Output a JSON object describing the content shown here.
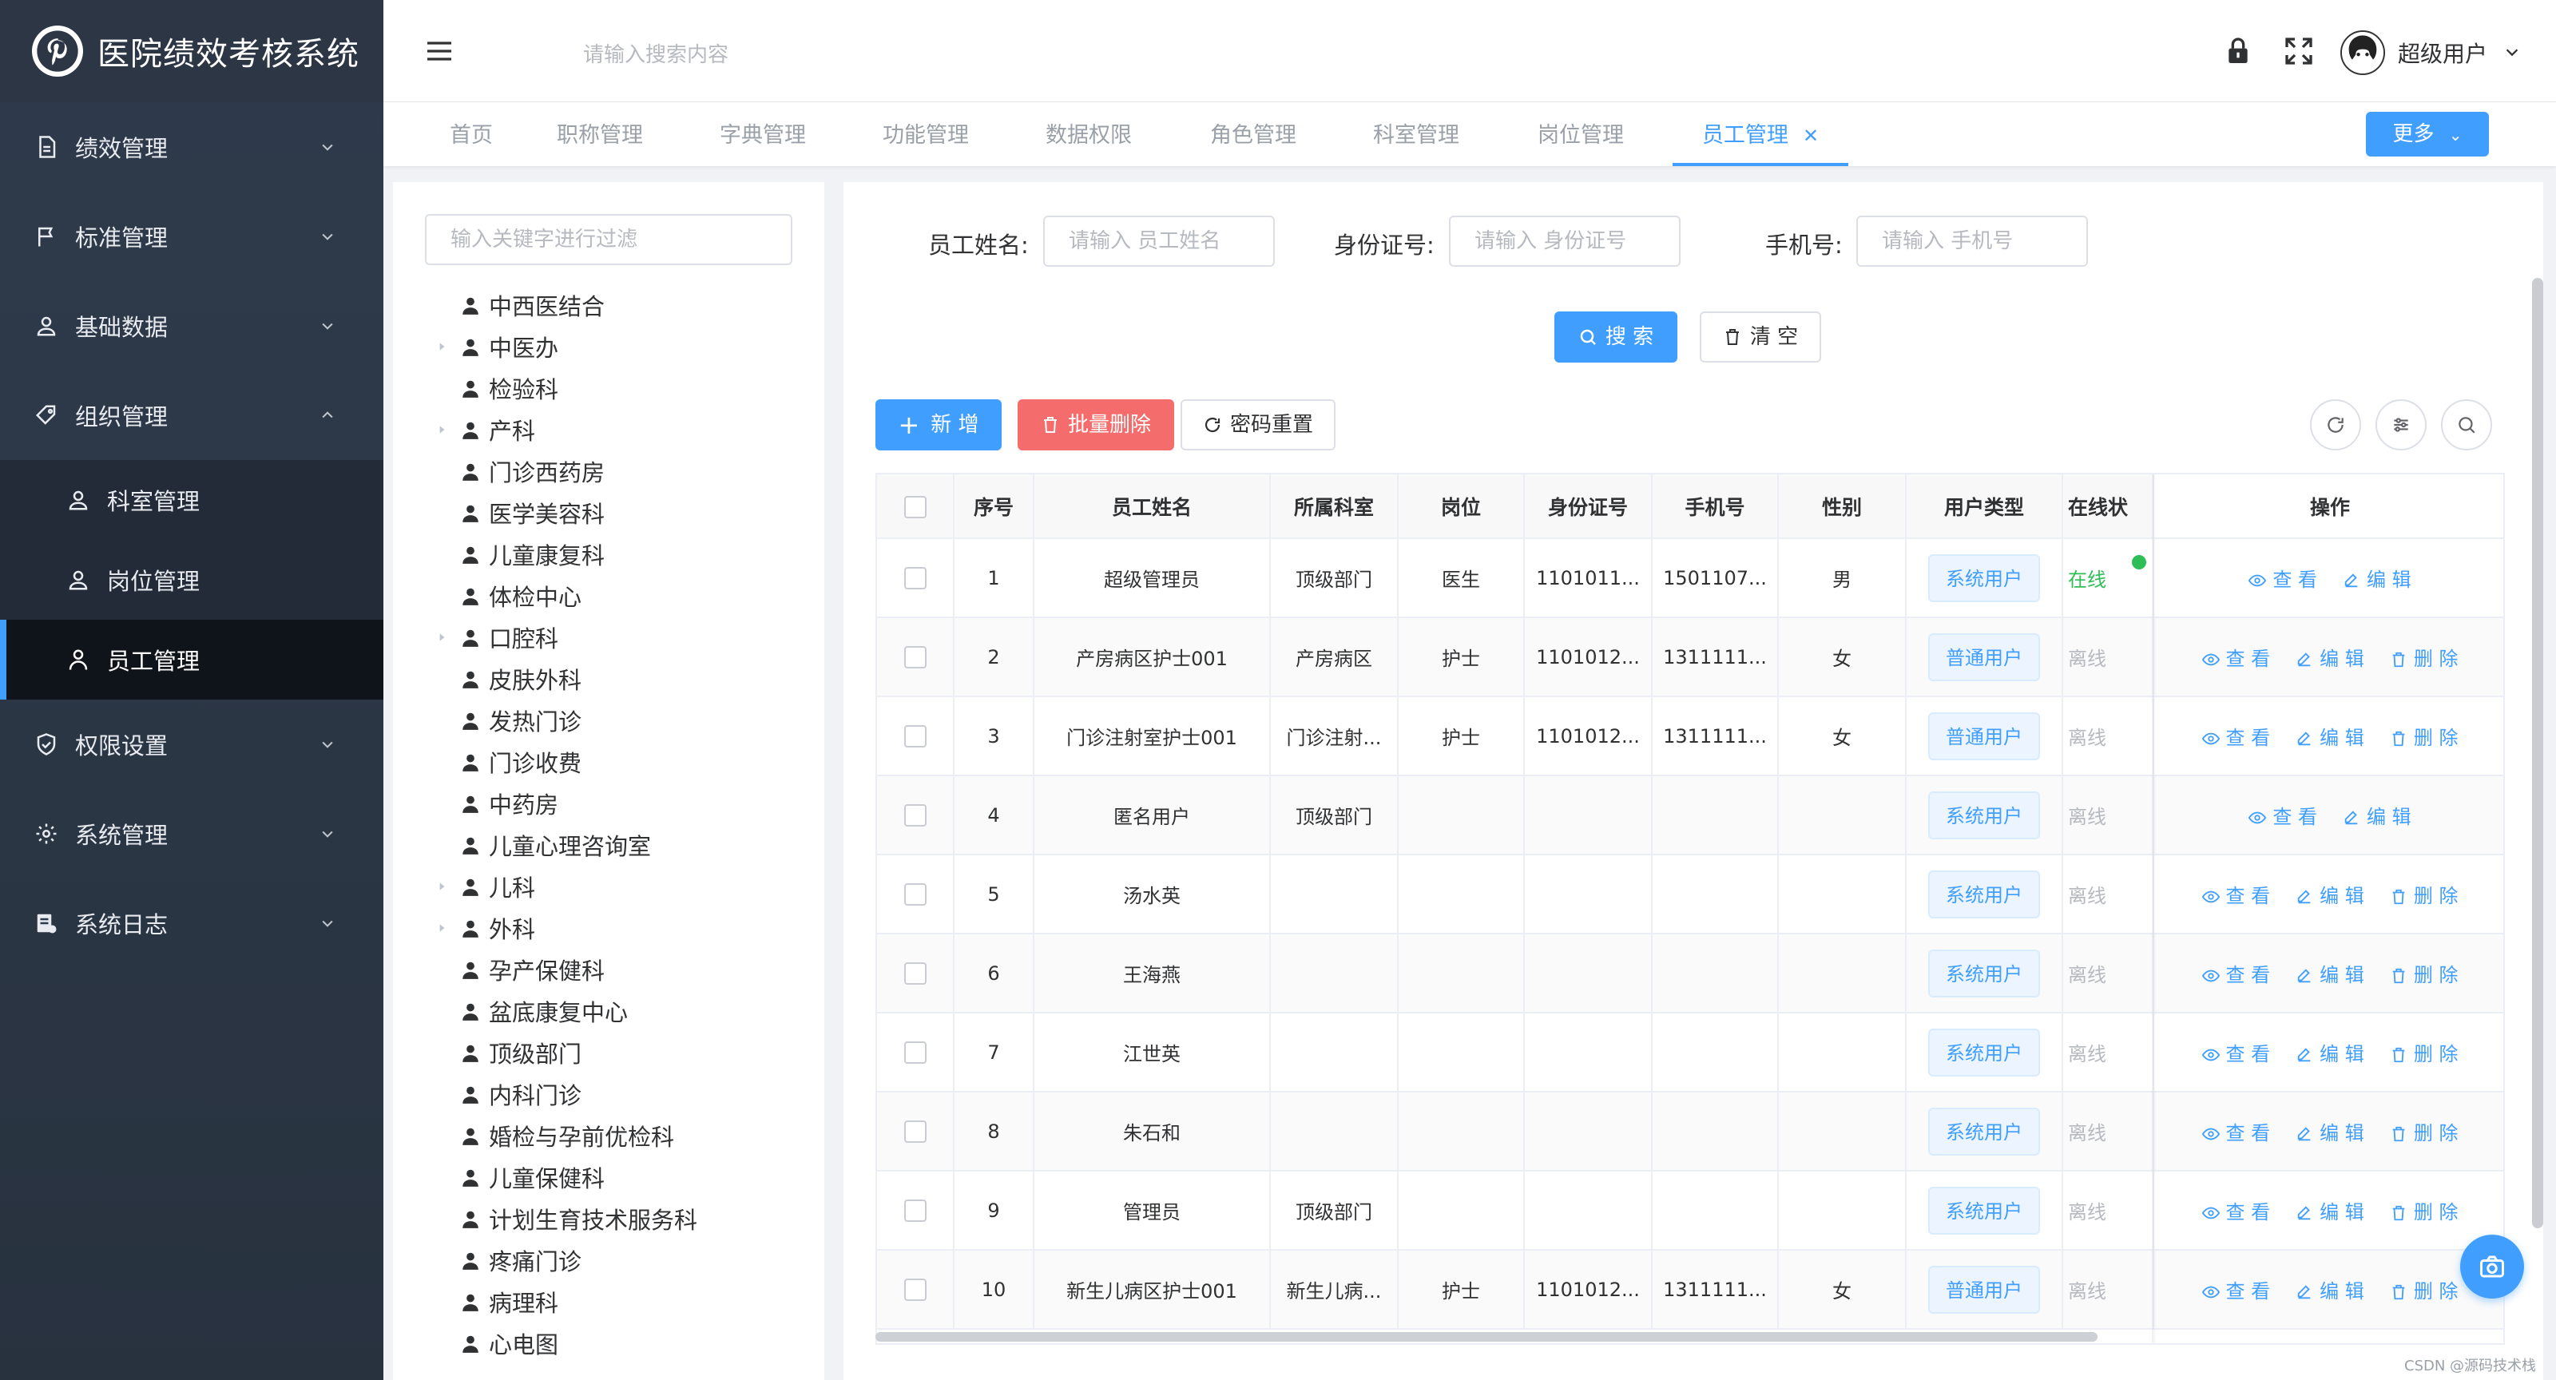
{
  "app": {
    "title": "医院绩效考核系统"
  },
  "sidebar": {
    "items": [
      {
        "label": "绩效管理",
        "icon": "document-icon"
      },
      {
        "label": "标准管理",
        "icon": "flag-icon"
      },
      {
        "label": "基础数据",
        "icon": "user-icon"
      },
      {
        "label": "组织管理",
        "icon": "tag-icon",
        "expanded": true
      },
      {
        "label": "科室管理",
        "icon": "user-icon",
        "sub": true
      },
      {
        "label": "岗位管理",
        "icon": "user-icon",
        "sub": true
      },
      {
        "label": "员工管理",
        "icon": "person-icon",
        "sub": true,
        "active": true
      },
      {
        "label": "权限设置",
        "icon": "shield-icon"
      },
      {
        "label": "系统管理",
        "icon": "gear-icon"
      },
      {
        "label": "系统日志",
        "icon": "log-icon"
      }
    ]
  },
  "header": {
    "search_placeholder": "请输入搜索内容",
    "username": "超级用户"
  },
  "tabs": {
    "items": [
      "首页",
      "职称管理",
      "字典管理",
      "功能管理",
      "数据权限",
      "角色管理",
      "科室管理",
      "岗位管理",
      "员工管理"
    ],
    "active_index": 8,
    "more_label": "更多"
  },
  "tree": {
    "filter_placeholder": "输入关键字进行过滤",
    "nodes": [
      {
        "label": "中西医结合",
        "expandable": false
      },
      {
        "label": "中医办",
        "expandable": true
      },
      {
        "label": "检验科",
        "expandable": false
      },
      {
        "label": "产科",
        "expandable": true
      },
      {
        "label": "门诊西药房",
        "expandable": false
      },
      {
        "label": "医学美容科",
        "expandable": false
      },
      {
        "label": "儿童康复科",
        "expandable": false
      },
      {
        "label": "体检中心",
        "expandable": false
      },
      {
        "label": "口腔科",
        "expandable": true
      },
      {
        "label": "皮肤外科",
        "expandable": false
      },
      {
        "label": "发热门诊",
        "expandable": false
      },
      {
        "label": "门诊收费",
        "expandable": false
      },
      {
        "label": "中药房",
        "expandable": false
      },
      {
        "label": "儿童心理咨询室",
        "expandable": false
      },
      {
        "label": "儿科",
        "expandable": true
      },
      {
        "label": "外科",
        "expandable": true
      },
      {
        "label": "孕产保健科",
        "expandable": false
      },
      {
        "label": "盆底康复中心",
        "expandable": false
      },
      {
        "label": "顶级部门",
        "expandable": false
      },
      {
        "label": "内科门诊",
        "expandable": false
      },
      {
        "label": "婚检与孕前优检科",
        "expandable": false
      },
      {
        "label": "儿童保健科",
        "expandable": false
      },
      {
        "label": "计划生育技术服务科",
        "expandable": false
      },
      {
        "label": "疼痛门诊",
        "expandable": false
      },
      {
        "label": "病理科",
        "expandable": false
      },
      {
        "label": "心电图",
        "expandable": false
      }
    ]
  },
  "search": {
    "name_label": "员工姓名:",
    "name_placeholder": "请输入 员工姓名",
    "id_label": "身份证号:",
    "id_placeholder": "请输入 身份证号",
    "phone_label": "手机号:",
    "phone_placeholder": "请输入 手机号",
    "search_button": "搜 索",
    "clear_button": "清 空"
  },
  "toolbar": {
    "add_button": "新 增",
    "batch_delete_button": "批量删除",
    "reset_password_button": "密码重置"
  },
  "table": {
    "columns": [
      "序号",
      "员工姓名",
      "所属科室",
      "岗位",
      "身份证号",
      "手机号",
      "性别",
      "用户类型",
      "在线状",
      "操作"
    ],
    "op_view": "查 看",
    "op_edit": "编 辑",
    "op_delete": "删 除",
    "rows": [
      {
        "no": "1",
        "name": "超级管理员",
        "dept": "顶级部门",
        "post": "医生",
        "id": "1101011...",
        "phone": "1501107...",
        "gender": "男",
        "type": "系统用户",
        "status": "在线",
        "deletable": false
      },
      {
        "no": "2",
        "name": "产房病区护士001",
        "dept": "产房病区",
        "post": "护士",
        "id": "1101012...",
        "phone": "1311111...",
        "gender": "女",
        "type": "普通用户",
        "status": "离线",
        "deletable": true
      },
      {
        "no": "3",
        "name": "门诊注射室护士001",
        "dept": "门诊注射...",
        "post": "护士",
        "id": "1101012...",
        "phone": "1311111...",
        "gender": "女",
        "type": "普通用户",
        "status": "离线",
        "deletable": true
      },
      {
        "no": "4",
        "name": "匿名用户",
        "dept": "顶级部门",
        "post": "",
        "id": "",
        "phone": "",
        "gender": "",
        "type": "系统用户",
        "status": "离线",
        "deletable": false
      },
      {
        "no": "5",
        "name": "汤水英",
        "dept": "",
        "post": "",
        "id": "",
        "phone": "",
        "gender": "",
        "type": "系统用户",
        "status": "离线",
        "deletable": true
      },
      {
        "no": "6",
        "name": "王海燕",
        "dept": "",
        "post": "",
        "id": "",
        "phone": "",
        "gender": "",
        "type": "系统用户",
        "status": "离线",
        "deletable": true
      },
      {
        "no": "7",
        "name": "江世英",
        "dept": "",
        "post": "",
        "id": "",
        "phone": "",
        "gender": "",
        "type": "系统用户",
        "status": "离线",
        "deletable": true
      },
      {
        "no": "8",
        "name": "朱石和",
        "dept": "",
        "post": "",
        "id": "",
        "phone": "",
        "gender": "",
        "type": "系统用户",
        "status": "离线",
        "deletable": true
      },
      {
        "no": "9",
        "name": "管理员",
        "dept": "顶级部门",
        "post": "",
        "id": "",
        "phone": "",
        "gender": "",
        "type": "系统用户",
        "status": "离线",
        "deletable": true
      },
      {
        "no": "10",
        "name": "新生儿病区护士001",
        "dept": "新生儿病...",
        "post": "护士",
        "id": "1101012...",
        "phone": "1311111...",
        "gender": "女",
        "type": "普通用户",
        "status": "离线",
        "deletable": true
      }
    ]
  },
  "watermark": "CSDN @源码技术栈",
  "colors": {
    "primary": "#409eff",
    "danger": "#f56c6c",
    "sidebar": "#2d3a4b",
    "online": "#2fbd56"
  }
}
